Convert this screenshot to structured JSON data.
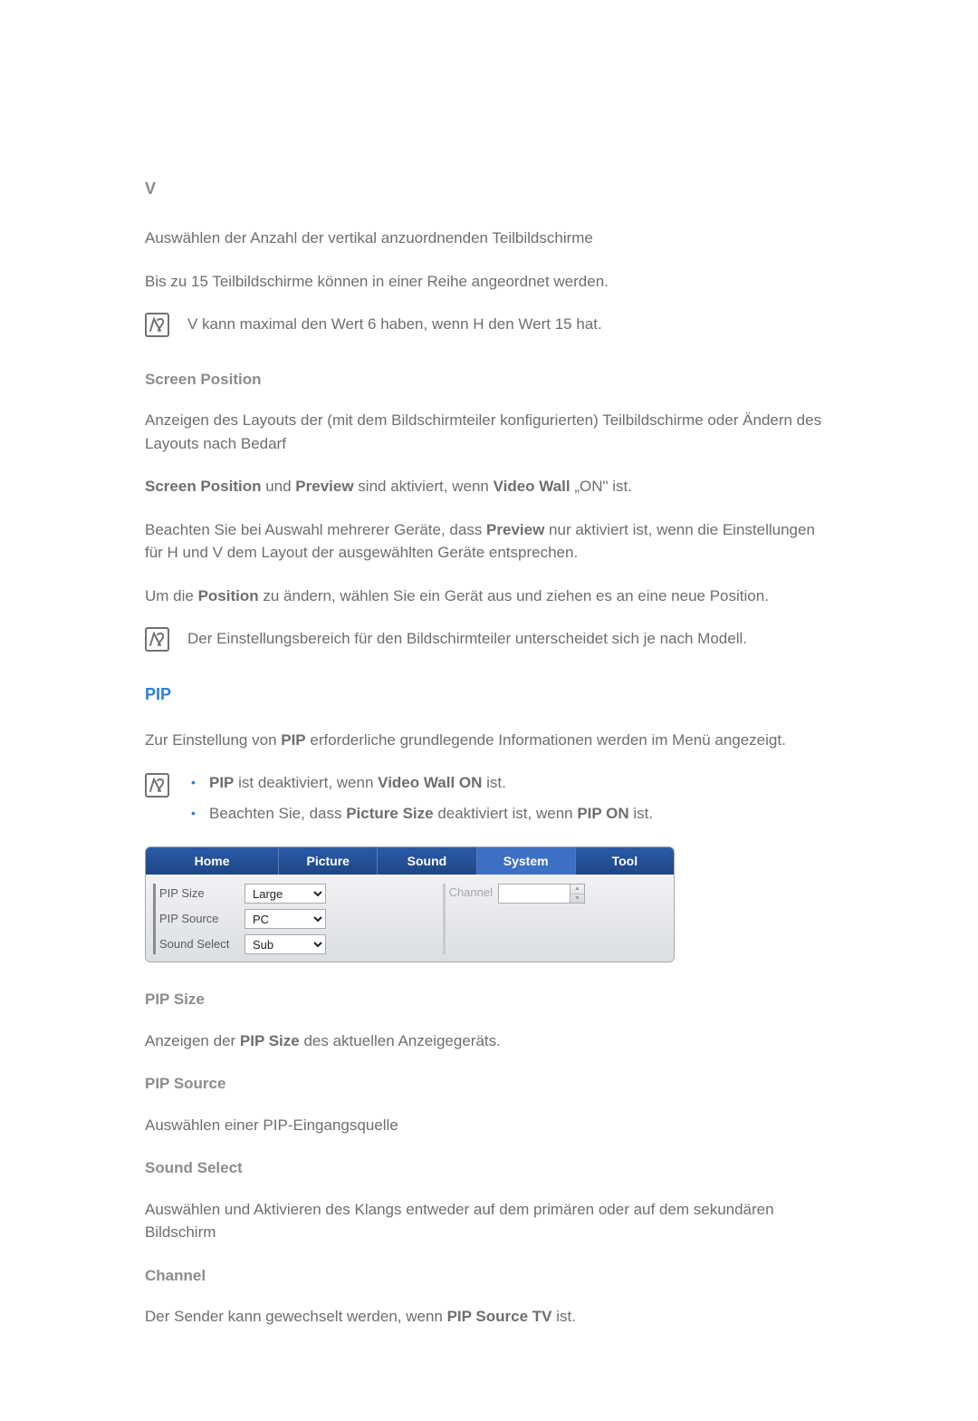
{
  "v": {
    "heading": "V",
    "p1": "Auswählen der Anzahl der vertikal anzuordnenden Teilbildschirme",
    "p2": "Bis zu 15 Teilbildschirme können in einer Reihe angeordnet werden.",
    "note": "V kann maximal den Wert 6 haben, wenn H den Wert 15 hat."
  },
  "screen_position": {
    "heading": "Screen Position",
    "p1": "Anzeigen des Layouts der (mit dem Bildschirmteiler konfigurierten) Teilbildschirme oder Ändern des Layouts nach Bedarf",
    "p2_pre": "Screen Position",
    "p2_mid1": " und ",
    "p2_bold2": "Preview",
    "p2_mid2": " sind aktiviert, wenn ",
    "p2_bold3": "Video Wall",
    "p2_suffix": " „ON\" ist.",
    "p3_pre": "Beachten Sie bei Auswahl mehrerer Geräte, dass ",
    "p3_bold": "Preview",
    "p3_suffix": " nur aktiviert ist, wenn die Einstellungen für H und V dem Layout der ausgewählten Geräte entsprechen.",
    "p4_pre": "Um die ",
    "p4_bold": "Position",
    "p4_suffix": " zu ändern, wählen Sie ein Gerät aus und ziehen es an eine neue Position.",
    "note": "Der Einstellungsbereich für den Bildschirmteiler unterscheidet sich je nach Modell."
  },
  "pip": {
    "heading": "PIP",
    "p1_pre": "Zur Einstellung von ",
    "p1_bold": "PIP",
    "p1_suffix": " erforderliche grundlegende Informationen werden im Menü angezeigt.",
    "bullets": {
      "b1_bold1": "PIP",
      "b1_mid": " ist deaktiviert, wenn ",
      "b1_bold2": "Video Wall ON",
      "b1_suffix": " ist.",
      "b2_pre": "Beachten Sie, dass ",
      "b2_bold1": "Picture Size",
      "b2_mid": " deaktiviert ist, wenn ",
      "b2_bold2": "PIP ON",
      "b2_suffix": " ist."
    }
  },
  "ui": {
    "tabs": [
      "Home",
      "Picture",
      "Sound",
      "System",
      "Tool"
    ],
    "rows": [
      {
        "label": "PIP Size",
        "value": "Large"
      },
      {
        "label": "PIP Source",
        "value": "PC"
      },
      {
        "label": "Sound Select",
        "value": "Sub"
      }
    ],
    "channel_label": "Channel"
  },
  "pip_size": {
    "heading": "PIP Size",
    "p_pre": "Anzeigen der ",
    "p_bold": "PIP Size",
    "p_suffix": " des aktuellen Anzeigegeräts."
  },
  "pip_source": {
    "heading": "PIP Source",
    "p": "Auswählen einer PIP-Eingangsquelle"
  },
  "sound_select": {
    "heading": "Sound Select",
    "p": "Auswählen und Aktivieren des Klangs entweder auf dem primären oder auf dem sekundären Bildschirm"
  },
  "channel": {
    "heading": "Channel",
    "p_pre": "Der Sender kann gewechselt werden, wenn ",
    "p_bold": "PIP Source TV",
    "p_suffix": " ist."
  }
}
